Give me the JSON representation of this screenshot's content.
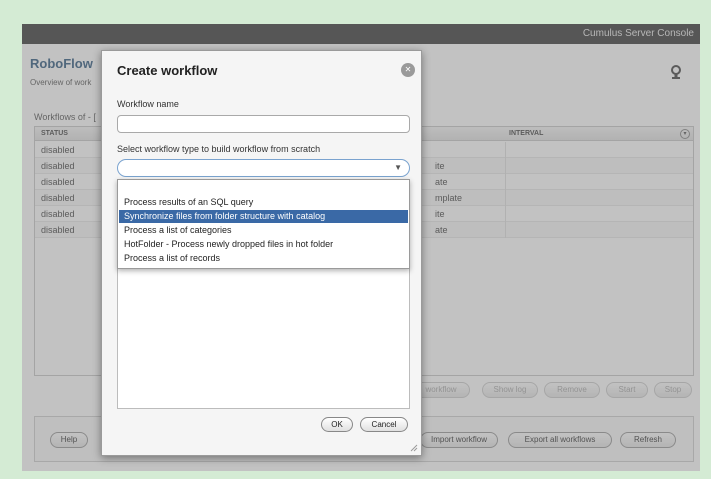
{
  "app": {
    "title": "Cumulus Server Console"
  },
  "background": {
    "heading": "RoboFlow",
    "subtitle": "Overview of work",
    "workflows_label": "Workflows of - [",
    "table": {
      "columns": [
        "STATUS",
        "INTERVAL"
      ],
      "rows": [
        {
          "status": "disabled",
          "template": ""
        },
        {
          "status": "disabled",
          "template": "ite"
        },
        {
          "status": "disabled",
          "template": "ate"
        },
        {
          "status": "disabled",
          "template": "mplate"
        },
        {
          "status": "disabled",
          "template": "ite"
        },
        {
          "status": "disabled",
          "template": "ate"
        }
      ]
    },
    "row_actions": {
      "edit_workflow": "workflow",
      "show_log": "Show log",
      "remove": "Remove",
      "start": "Start",
      "stop": "Stop"
    },
    "bottom_actions": {
      "help": "Help",
      "import_workflow": "Import workflow",
      "export_all": "Export all workflows",
      "refresh": "Refresh"
    },
    "dot": "."
  },
  "dialog": {
    "title": "Create workflow",
    "name_label": "Workflow name",
    "name_value": "",
    "type_label": "Select workflow type to build workflow from scratch",
    "type_value": "",
    "options": [
      "Process results of an SQL query",
      "Synchronize files from folder structure with catalog",
      "Process a list of categories",
      "HotFolder - Process newly dropped files in hot folder",
      "Process a list of records"
    ],
    "highlighted_option_index": 1,
    "ok_label": "OK",
    "cancel_label": "Cancel"
  },
  "colors": {
    "page_bg": "#d4ebd4",
    "topbar": "#3b3b3b",
    "heading": "#305a80",
    "selection": "#3a69a6"
  }
}
